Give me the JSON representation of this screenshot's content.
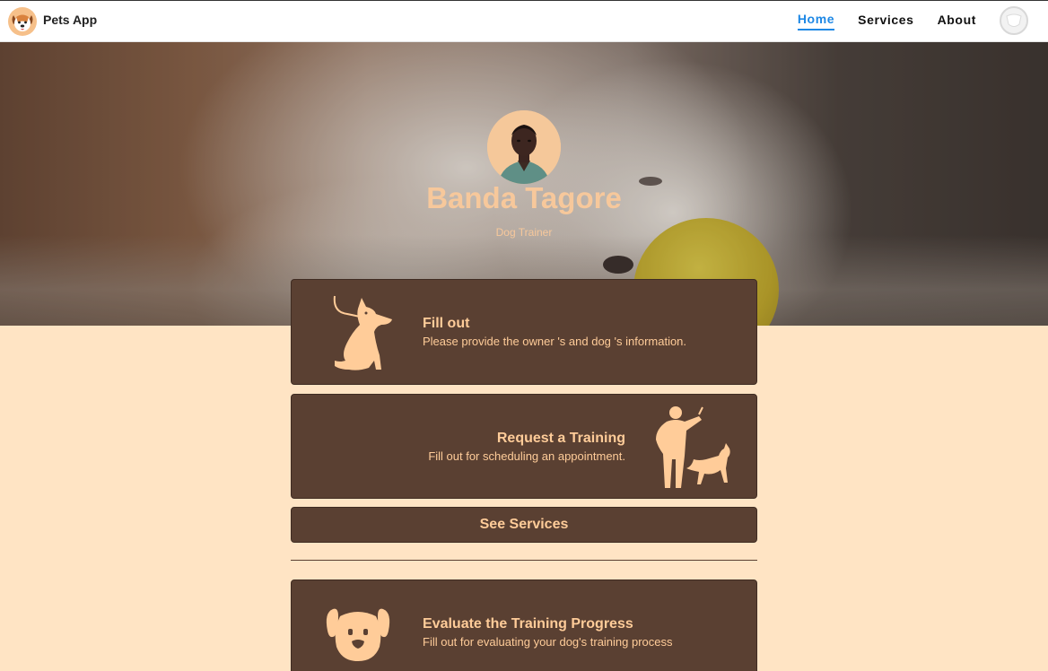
{
  "app": {
    "name": "Pets App"
  },
  "nav": {
    "items": [
      {
        "label": "Home",
        "active": true
      },
      {
        "label": "Services",
        "active": false
      },
      {
        "label": "About",
        "active": false
      }
    ]
  },
  "profile": {
    "name": "Banda Tagore",
    "role": "Dog Trainer"
  },
  "cards": [
    {
      "title": "Fill out",
      "text": "Please provide the owner 's and dog 's information.",
      "icon": "sitting-dog-icon"
    },
    {
      "title": "Request a Training",
      "text": "Fill out for scheduling an appointment.",
      "icon": "trainer-with-dog-icon"
    },
    {
      "title": "Evaluate the Training Progress",
      "text": "Fill out for evaluating your dog's training process",
      "icon": "dog-face-icon"
    }
  ],
  "services_button": {
    "label": "See Services"
  },
  "colors": {
    "card": "#5a4032",
    "accent_text": "#ffcc99",
    "page_background": "#ffe4c4",
    "nav_active": "#1e88e5"
  }
}
